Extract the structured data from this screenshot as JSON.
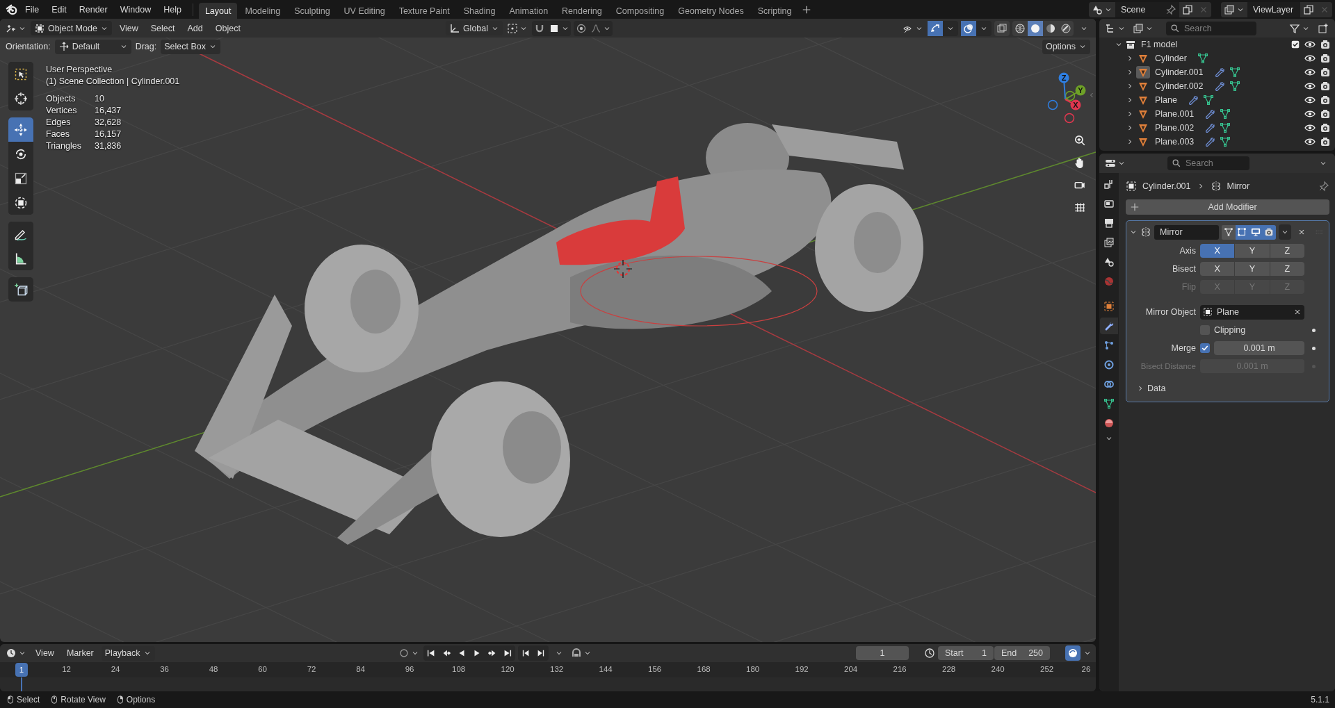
{
  "menu": [
    "File",
    "Edit",
    "Render",
    "Window",
    "Help"
  ],
  "workspaces": [
    {
      "label": "Layout",
      "selected": true
    },
    {
      "label": "Modeling",
      "selected": false
    },
    {
      "label": "Sculpting",
      "selected": false
    },
    {
      "label": "UV Editing",
      "selected": false
    },
    {
      "label": "Texture Paint",
      "selected": false
    },
    {
      "label": "Shading",
      "selected": false
    },
    {
      "label": "Animation",
      "selected": false
    },
    {
      "label": "Rendering",
      "selected": false
    },
    {
      "label": "Compositing",
      "selected": false
    },
    {
      "label": "Geometry Nodes",
      "selected": false
    },
    {
      "label": "Scripting",
      "selected": false
    }
  ],
  "scene": "Scene",
  "view_layer": "ViewLayer",
  "viewport": {
    "mode": "Object Mode",
    "menus": [
      "View",
      "Select",
      "Add",
      "Object"
    ],
    "transform_orientation": "Global",
    "orientation_label": "Orientation:",
    "orientation": "Default",
    "drag_label": "Drag:",
    "drag": "Select Box",
    "options": "Options",
    "view_name": "User Perspective",
    "collection_line": "(1) Scene Collection | Cylinder.001",
    "stats": [
      {
        "label": "Objects",
        "value": "10"
      },
      {
        "label": "Vertices",
        "value": "16,437"
      },
      {
        "label": "Edges",
        "value": "32,628"
      },
      {
        "label": "Faces",
        "value": "16,157"
      },
      {
        "label": "Triangles",
        "value": "31,836"
      }
    ],
    "tools": [
      {
        "kind": "select",
        "selected": false
      },
      {
        "kind": "cursor",
        "selected": false
      },
      {
        "kind": "move",
        "selected": true
      },
      {
        "kind": "rotate",
        "selected": false
      },
      {
        "kind": "scale",
        "selected": false
      },
      {
        "kind": "transform",
        "selected": false
      },
      {
        "kind": "annotate",
        "selected": false
      },
      {
        "kind": "measure",
        "selected": false
      },
      {
        "kind": "add-cube",
        "selected": false
      }
    ],
    "shading": [
      {
        "kind": "wireframe",
        "selected": false
      },
      {
        "kind": "solid",
        "selected": true
      },
      {
        "kind": "material",
        "selected": false
      },
      {
        "kind": "rendered",
        "selected": false
      }
    ],
    "gizmo": [
      {
        "axis": "Z",
        "color": "#2f7ee0"
      },
      {
        "axis": "Y",
        "color": "#6ea127"
      },
      {
        "axis": "X",
        "color": "#e0374f"
      }
    ]
  },
  "outliner": {
    "search_placeholder": "Search",
    "collection": {
      "name": "F1 model",
      "expanded": true,
      "checked": true
    },
    "items": [
      {
        "name": "Cylinder",
        "expanded": false,
        "selected": false,
        "modifier": false
      },
      {
        "name": "Cylinder.001",
        "expanded": false,
        "selected": true,
        "modifier": true
      },
      {
        "name": "Cylinder.002",
        "expanded": false,
        "selected": false,
        "modifier": true
      },
      {
        "name": "Plane",
        "expanded": false,
        "selected": false,
        "modifier": true
      },
      {
        "name": "Plane.001",
        "expanded": false,
        "selected": false,
        "modifier": true
      },
      {
        "name": "Plane.002",
        "expanded": false,
        "selected": false,
        "modifier": true
      },
      {
        "name": "Plane.003",
        "expanded": false,
        "selected": false,
        "modifier": true
      }
    ]
  },
  "properties": {
    "search_placeholder": "Search",
    "tabs": [
      {
        "kind": "tool",
        "selected": false
      },
      {
        "kind": "render",
        "selected": false
      },
      {
        "kind": "output",
        "selected": false
      },
      {
        "kind": "view-layer",
        "selected": false
      },
      {
        "kind": "scene",
        "selected": false
      },
      {
        "kind": "world",
        "selected": false
      },
      {
        "kind": "object",
        "selected": false
      },
      {
        "kind": "modifiers",
        "selected": true
      },
      {
        "kind": "particles",
        "selected": false
      },
      {
        "kind": "physics",
        "selected": false
      },
      {
        "kind": "constraints",
        "selected": false
      },
      {
        "kind": "data",
        "selected": false
      },
      {
        "kind": "material",
        "selected": false
      }
    ],
    "object": "Cylinder.001",
    "modifier_crumb": "Mirror",
    "add_modifier": "Add Modifier",
    "modifier": {
      "name": "Mirror",
      "expanded": true,
      "header_toggles": [
        {
          "kind": "cage",
          "selected": false
        },
        {
          "kind": "edit-mode",
          "selected": true
        },
        {
          "kind": "viewport",
          "selected": true
        },
        {
          "kind": "render",
          "selected": true
        }
      ],
      "rows": [
        {
          "label": "Axis",
          "disabled": false,
          "toggles": [
            {
              "label": "X",
              "selected": true
            },
            {
              "label": "Y",
              "selected": false
            },
            {
              "label": "Z",
              "selected": false
            }
          ]
        },
        {
          "label": "Bisect",
          "disabled": false,
          "toggles": [
            {
              "label": "X",
              "selected": false
            },
            {
              "label": "Y",
              "selected": false
            },
            {
              "label": "Z",
              "selected": false
            }
          ]
        },
        {
          "label": "Flip",
          "disabled": true,
          "toggles": [
            {
              "label": "X",
              "selected": false
            },
            {
              "label": "Y",
              "selected": false
            },
            {
              "label": "Z",
              "selected": false
            }
          ]
        }
      ],
      "mirror_object_label": "Mirror Object",
      "mirror_object": "Plane",
      "clipping": {
        "label": "Clipping",
        "checked": false
      },
      "merge": {
        "label": "Merge",
        "checked": true,
        "value": "0.001 m"
      },
      "bisect_distance": {
        "label": "Bisect Distance",
        "value": "0.001 m",
        "disabled": true
      },
      "data": {
        "label": "Data",
        "expanded": false
      }
    }
  },
  "timeline": {
    "menus": [
      "View",
      "Marker"
    ],
    "playback": "Playback",
    "current_frame": "1",
    "start_label": "Start",
    "start": "1",
    "end_label": "End",
    "end": "250",
    "playhead": "1",
    "ticks": [
      "12",
      "24",
      "36",
      "48",
      "60",
      "72",
      "84",
      "96",
      "108",
      "120",
      "132",
      "144",
      "156",
      "168",
      "180",
      "192",
      "204",
      "216",
      "228",
      "240",
      "252",
      "26"
    ]
  },
  "status_bar": {
    "items": [
      {
        "kind": "left",
        "label": "Select"
      },
      {
        "kind": "middle",
        "label": "Rotate View"
      },
      {
        "kind": "right",
        "label": "Options"
      }
    ],
    "version": "5.1.1"
  }
}
